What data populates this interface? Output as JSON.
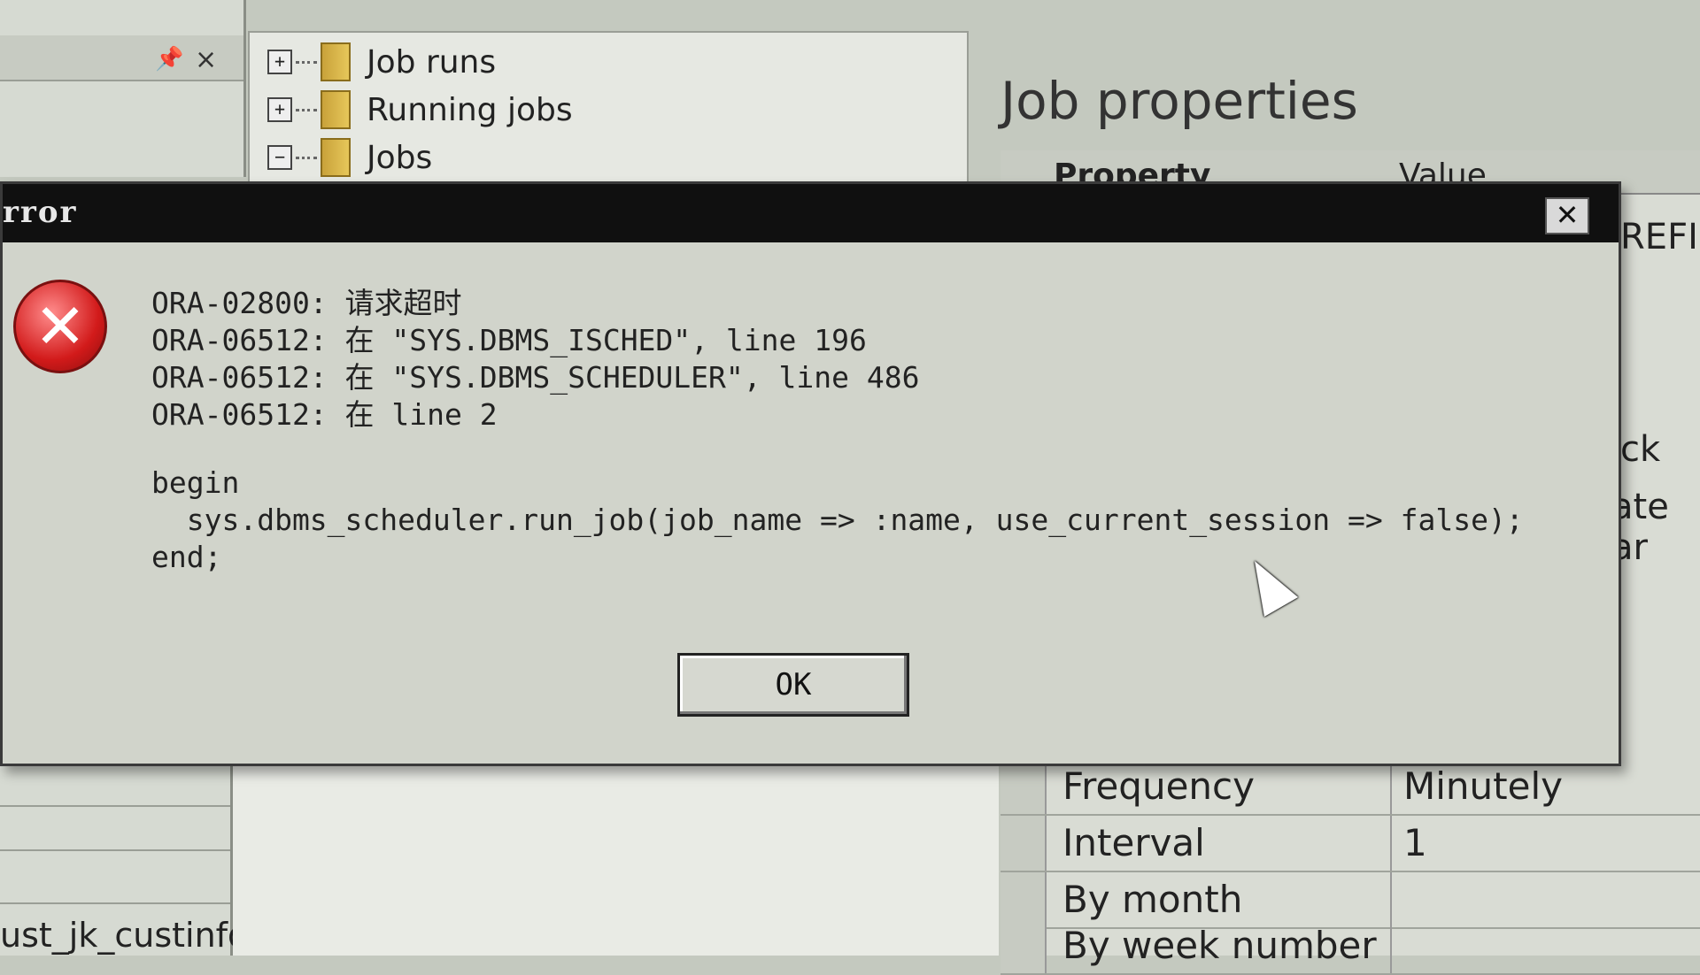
{
  "tree": {
    "items": [
      {
        "expander": "+",
        "label": "Job runs"
      },
      {
        "expander": "+",
        "label": "Running jobs"
      },
      {
        "expander": "−",
        "label": "Jobs"
      }
    ]
  },
  "props": {
    "title": "Job properties",
    "header_property": "Property",
    "header_value": "Value",
    "stub_refresh": "REFI",
    "stub_ck": "ck",
    "stub_ate": "ate ar",
    "rows": [
      {
        "name": "Frequency",
        "value": "Minutely"
      },
      {
        "name": "Interval",
        "value": "1"
      },
      {
        "name": "By month",
        "value": ""
      },
      {
        "name": "By week number",
        "value": ""
      }
    ]
  },
  "left_bottom": {
    "item_label": "ust_jk_custinfo"
  },
  "dialog": {
    "title": "rror",
    "close_label": "✕",
    "lines": [
      "ORA-02800: 请求超时",
      "ORA-06512: 在 \"SYS.DBMS_ISCHED\", line 196",
      "ORA-06512: 在 \"SYS.DBMS_SCHEDULER\", line 486",
      "ORA-06512: 在 line 2"
    ],
    "code": [
      "begin",
      "  sys.dbms_scheduler.run_job(job_name => :name, use_current_session => false);",
      "end;"
    ],
    "ok_label": "OK"
  }
}
